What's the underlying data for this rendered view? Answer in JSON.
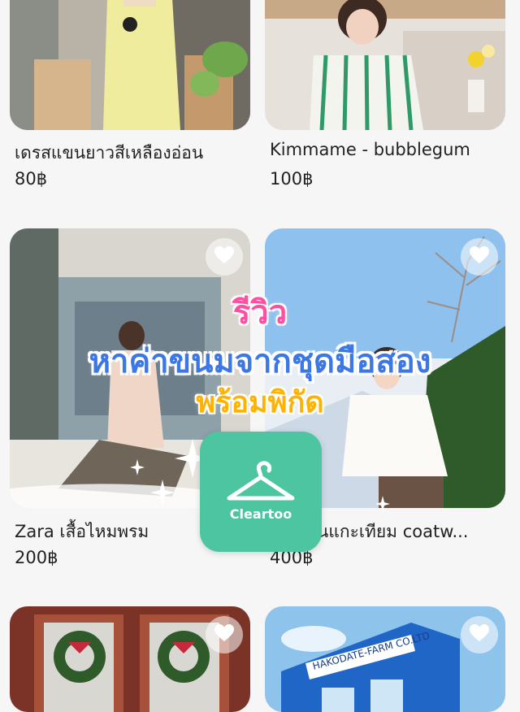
{
  "products": [
    {
      "title": "เดรสแขนยาวสีเหลืองอ่อน",
      "price": "80฿"
    },
    {
      "title": "Kimmame - bubblegum",
      "price": "100฿"
    },
    {
      "title": "Zara เสื้อไหมพรม",
      "price": "200฿"
    },
    {
      "title": "...าวขนแกะเทียม coatw...",
      "price": "400฿"
    }
  ],
  "overlay": {
    "line1": "รีวิว",
    "line2": "หาค่าขนมจากชุดมือสอง",
    "line3": "พร้อมพิกัด"
  },
  "logo": {
    "name": "Cleartoo"
  },
  "colors": {
    "pink": "#ff4fa0",
    "blue": "#3c77e6",
    "yellow": "#ffb300",
    "brand": "#4cc5a0"
  }
}
